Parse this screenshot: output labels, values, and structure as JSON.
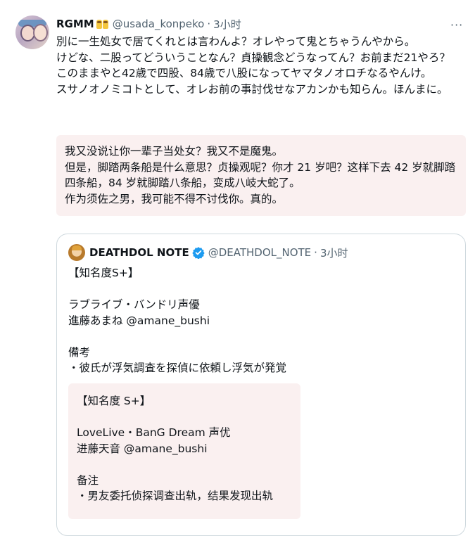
{
  "tweet": {
    "author_name": "RGMM",
    "author_handle": "@usada_konpeko",
    "time": "3小时",
    "more_icon": "more-horizontal-icon",
    "text": "別に一生処女で居てくれとは言わんよ？オレやって鬼とちゃうんやから。\nけどな、二股ってどういうことなん？貞操観念どうなってん？お前まだ21やろ？このままやと42歳で四股、84歳で八股になってヤマタノオロチなるやんけ。\nスサノオノミコトとして、オレお前の事討伐せなアカンかも知らん。ほんまに。",
    "translation": "我又没说让你一辈子当处女？我又不是魔鬼。\n但是，脚踏两条船是什么意思？贞操观呢？你才 21 岁吧？这样下去 42 岁就脚踏四条船，84 岁就脚踏八条船，变成八岐大蛇了。\n作为须佐之男，我可能不得不讨伐你。真的。"
  },
  "quote": {
    "author_name": "DEATHDOL NOTE",
    "author_handle": "@DEATHDOL_NOTE",
    "time": "3小时",
    "verified_icon": "verified-badge-icon",
    "text": "【知名度S+】\n\nラブライブ・バンドリ声優\n進藤あまね @amane_bushi\n\n備考\n・彼氏が浮気調査を探偵に依頼し浮気が発覚",
    "translation": "【知名度 S+】\n\nLoveLive・BanG Dream 声优\n进藤天音 @amane_bushi\n\n备注\n・男友委托侦探调查出轨，结果发现出轨"
  },
  "colors": {
    "text_primary": "#0f1419",
    "text_secondary": "#536471",
    "border": "#cfd9de",
    "translation_bg": "#faf0f0",
    "verified_blue": "#1d9bf0"
  }
}
